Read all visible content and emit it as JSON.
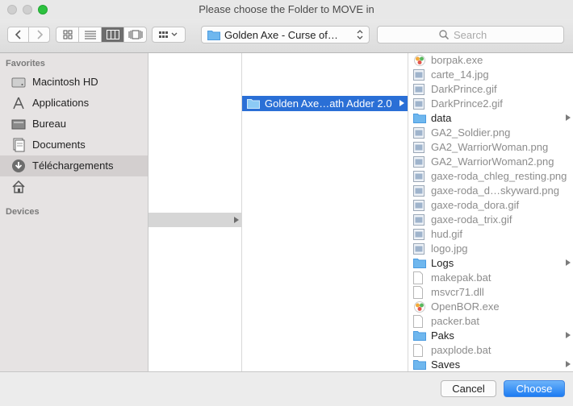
{
  "window": {
    "title": "Please choose the Folder to MOVE in"
  },
  "toolbar": {
    "path_label": "Golden Axe - Curse of…",
    "search_placeholder": "Search"
  },
  "sidebar": {
    "favorites_header": "Favorites",
    "devices_header": "Devices",
    "items": [
      {
        "label": "Macintosh HD",
        "icon": "hard-drive-icon"
      },
      {
        "label": "Applications",
        "icon": "applications-icon"
      },
      {
        "label": "Bureau",
        "icon": "desktop-icon"
      },
      {
        "label": "Documents",
        "icon": "documents-icon"
      },
      {
        "label": "Téléchargements",
        "icon": "downloads-icon"
      },
      {
        "label": "",
        "icon": "home-icon"
      }
    ]
  },
  "columns": {
    "col2_selected": "Golden Axe…ath Adder 2.0"
  },
  "files": [
    {
      "name": "borpak.exe",
      "kind": "app"
    },
    {
      "name": "carte_14.jpg",
      "kind": "image"
    },
    {
      "name": "DarkPrince.gif",
      "kind": "image"
    },
    {
      "name": "DarkPrince2.gif",
      "kind": "image"
    },
    {
      "name": "data",
      "kind": "folder"
    },
    {
      "name": "GA2_Soldier.png",
      "kind": "image"
    },
    {
      "name": "GA2_WarriorWoman.png",
      "kind": "image"
    },
    {
      "name": "GA2_WarriorWoman2.png",
      "kind": "image"
    },
    {
      "name": "gaxe-roda_chleg_resting.png",
      "kind": "image"
    },
    {
      "name": "gaxe-roda_d…skyward.png",
      "kind": "image"
    },
    {
      "name": "gaxe-roda_dora.gif",
      "kind": "image"
    },
    {
      "name": "gaxe-roda_trix.gif",
      "kind": "image"
    },
    {
      "name": "hud.gif",
      "kind": "image"
    },
    {
      "name": "logo.jpg",
      "kind": "image"
    },
    {
      "name": "Logs",
      "kind": "folder"
    },
    {
      "name": "makepak.bat",
      "kind": "doc"
    },
    {
      "name": "msvcr71.dll",
      "kind": "doc"
    },
    {
      "name": "OpenBOR.exe",
      "kind": "app"
    },
    {
      "name": "packer.bat",
      "kind": "doc"
    },
    {
      "name": "Paks",
      "kind": "folder"
    },
    {
      "name": "paxplode.bat",
      "kind": "doc"
    },
    {
      "name": "Saves",
      "kind": "folder"
    }
  ],
  "footer": {
    "cancel_label": "Cancel",
    "choose_label": "Choose"
  },
  "colors": {
    "accent": "#2a6fd6",
    "folder": "#6fb7ee"
  }
}
